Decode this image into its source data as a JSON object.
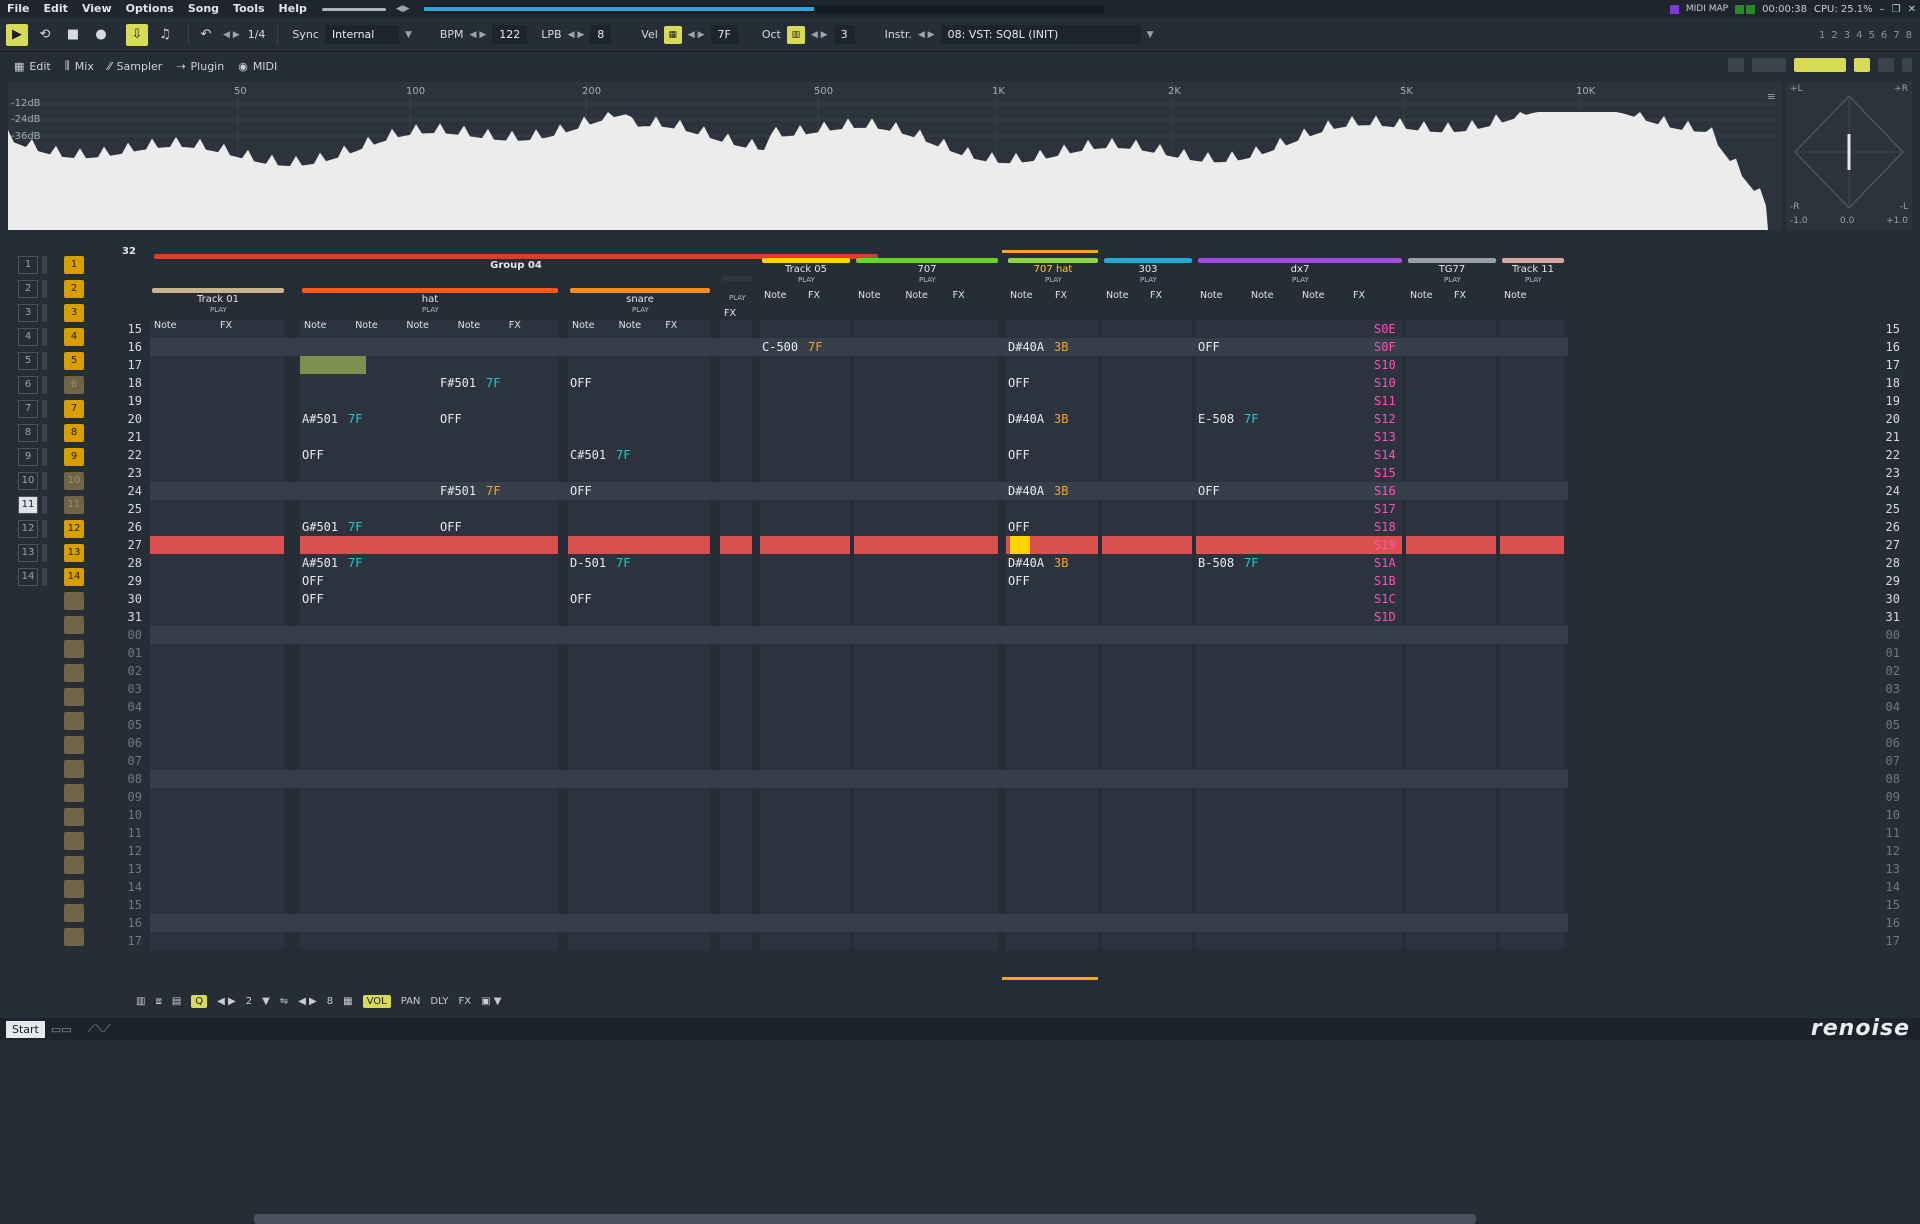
{
  "menu": [
    "File",
    "Edit",
    "View",
    "Options",
    "Song",
    "Tools",
    "Help"
  ],
  "status_right": {
    "midi_map": "MIDI MAP",
    "time": "00:00:38",
    "cpu": "CPU: 25.1%"
  },
  "toolbar": {
    "undo_ratio": "1/4",
    "sync_label": "Sync",
    "sync_value": "Internal",
    "bpm_label": "BPM",
    "bpm": "122",
    "lpb_label": "LPB",
    "lpb": "8",
    "vel_label": "Vel",
    "vel": "7F",
    "oct_label": "Oct",
    "oct": "3",
    "instr_label": "Instr.",
    "instr": "08: VST: SQ8L (INIT)"
  },
  "track_numbers": [
    "1",
    "2",
    "3",
    "4",
    "5",
    "6",
    "7",
    "8"
  ],
  "tabs": [
    "Edit",
    "Mix",
    "Sampler",
    "Plugin",
    "MIDI"
  ],
  "scope": {
    "db_labels": [
      "-12dB",
      "-24dB",
      "-36dB"
    ],
    "freq_labels": [
      "50",
      "100",
      "200",
      "500",
      "1K",
      "2K",
      "5K",
      "10K"
    ],
    "stereo_labels": [
      "+L",
      "+R",
      "-R",
      "-L",
      "-1.0",
      "0.0",
      "+1.0"
    ]
  },
  "sequence": {
    "rows": [
      "1",
      "2",
      "3",
      "4",
      "5",
      "6",
      "7",
      "8",
      "9",
      "10",
      "11",
      "12",
      "13",
      "14"
    ],
    "patterns": [
      "1",
      "2",
      "3",
      "4",
      "5",
      "6",
      "7",
      "8",
      "9",
      "10",
      "11",
      "12",
      "13",
      "14"
    ],
    "pattern_count": "32"
  },
  "groups": {
    "group_name": "Group 04"
  },
  "tracks": [
    {
      "name": "Track 01",
      "color": "#c8b48a",
      "cols": [
        "Note",
        "FX"
      ]
    },
    {
      "name": "hat",
      "color": "#ff5a1a",
      "cols": [
        "Note",
        "Note",
        "Note",
        "Note",
        "FX"
      ]
    },
    {
      "name": "snare",
      "color": "#ff8c1a",
      "cols": [
        "Note",
        "Note",
        "FX"
      ]
    },
    {
      "name": "",
      "color": "#2f3640",
      "cols": [
        "FX"
      ]
    },
    {
      "name": "Track 05",
      "color": "#ffd400",
      "cols": [
        "Note",
        "FX"
      ]
    },
    {
      "name": "707",
      "color": "#6ad425",
      "cols": [
        "Note",
        "Note",
        "FX"
      ]
    },
    {
      "name": "707 hat",
      "color": "#8bd63a",
      "cols": [
        "Note",
        "FX"
      ]
    },
    {
      "name": "303",
      "color": "#1fa9d6",
      "cols": [
        "Note",
        "FX"
      ]
    },
    {
      "name": "dx7",
      "color": "#a64be0",
      "cols": [
        "Note",
        "Note",
        "Note",
        "FX"
      ]
    },
    {
      "name": "TG77",
      "color": "#9aa0a6",
      "cols": [
        "Note",
        "FX"
      ]
    },
    {
      "name": "Track 11",
      "color": "#d8a8a0",
      "cols": [
        "Note"
      ]
    }
  ],
  "play_label": "PLAY",
  "rows": [
    "15",
    "16",
    "17",
    "18",
    "19",
    "20",
    "21",
    "22",
    "23",
    "24",
    "25",
    "26",
    "27",
    "28",
    "29",
    "30",
    "31",
    "00",
    "01",
    "02",
    "03",
    "04",
    "05",
    "06",
    "07",
    "08",
    "09",
    "10",
    "11",
    "12",
    "13",
    "14",
    "15",
    "16",
    "17"
  ],
  "notes": {
    "r20_hat": "A#501",
    "r20_hat_vol": "7F",
    "r18_hat3": "F#501",
    "r18_hat3_vol": "7F",
    "r20_hat3": "OFF",
    "r22_hat": "OFF",
    "r24_hat3": "F#501",
    "r24_hat3_vol": "7F",
    "r26_hat": "G#501",
    "r26_hat_vol": "7F",
    "r26_hat3": "OFF",
    "r28_hat": "A#501",
    "r28_hat_vol": "7F",
    "r29_hat": "OFF",
    "r30_hat": "OFF",
    "r18_snare": "OFF",
    "r22_snare": "C#501",
    "r22_snare_vol": "7F",
    "r24_snare": "OFF",
    "r28_snare": "D-501",
    "r28_snare_vol": "7F",
    "r30_snare": "OFF",
    "r16_t05": "C-500",
    "r16_t05_vol": "7F",
    "r16_hat707": "D#40A",
    "r16_hat707_vol": "3B",
    "r18_hat707": "OFF",
    "r20_hat707": "D#40A",
    "r20_hat707_vol": "3B",
    "r22_hat707": "OFF",
    "r24_hat707": "D#40A",
    "r24_hat707_vol": "3B",
    "r26_hat707": "OFF",
    "r28_hat707": "D#40A",
    "r28_hat707_vol": "3B",
    "r29_hat707": "OFF",
    "r16_dx7": "OFF",
    "r20_dx7": "E-508",
    "r20_dx7_vol": "7F",
    "r24_dx7": "OFF",
    "r28_dx7": "B-508",
    "r28_dx7_vol": "7F"
  },
  "dx7_fx": [
    "S0E",
    "S0F",
    "S10",
    "S10",
    "S11",
    "S12",
    "S13",
    "S14",
    "S15",
    "S16",
    "S17",
    "S18",
    "S19",
    "S1A",
    "S1B",
    "S1C",
    "S1D"
  ],
  "bottom": {
    "step": "2",
    "octave": "8",
    "vol": "VOL",
    "pan": "PAN",
    "dly": "DLY",
    "fx": "FX"
  },
  "taskbar": {
    "start": "Start"
  },
  "logo": "renoise"
}
